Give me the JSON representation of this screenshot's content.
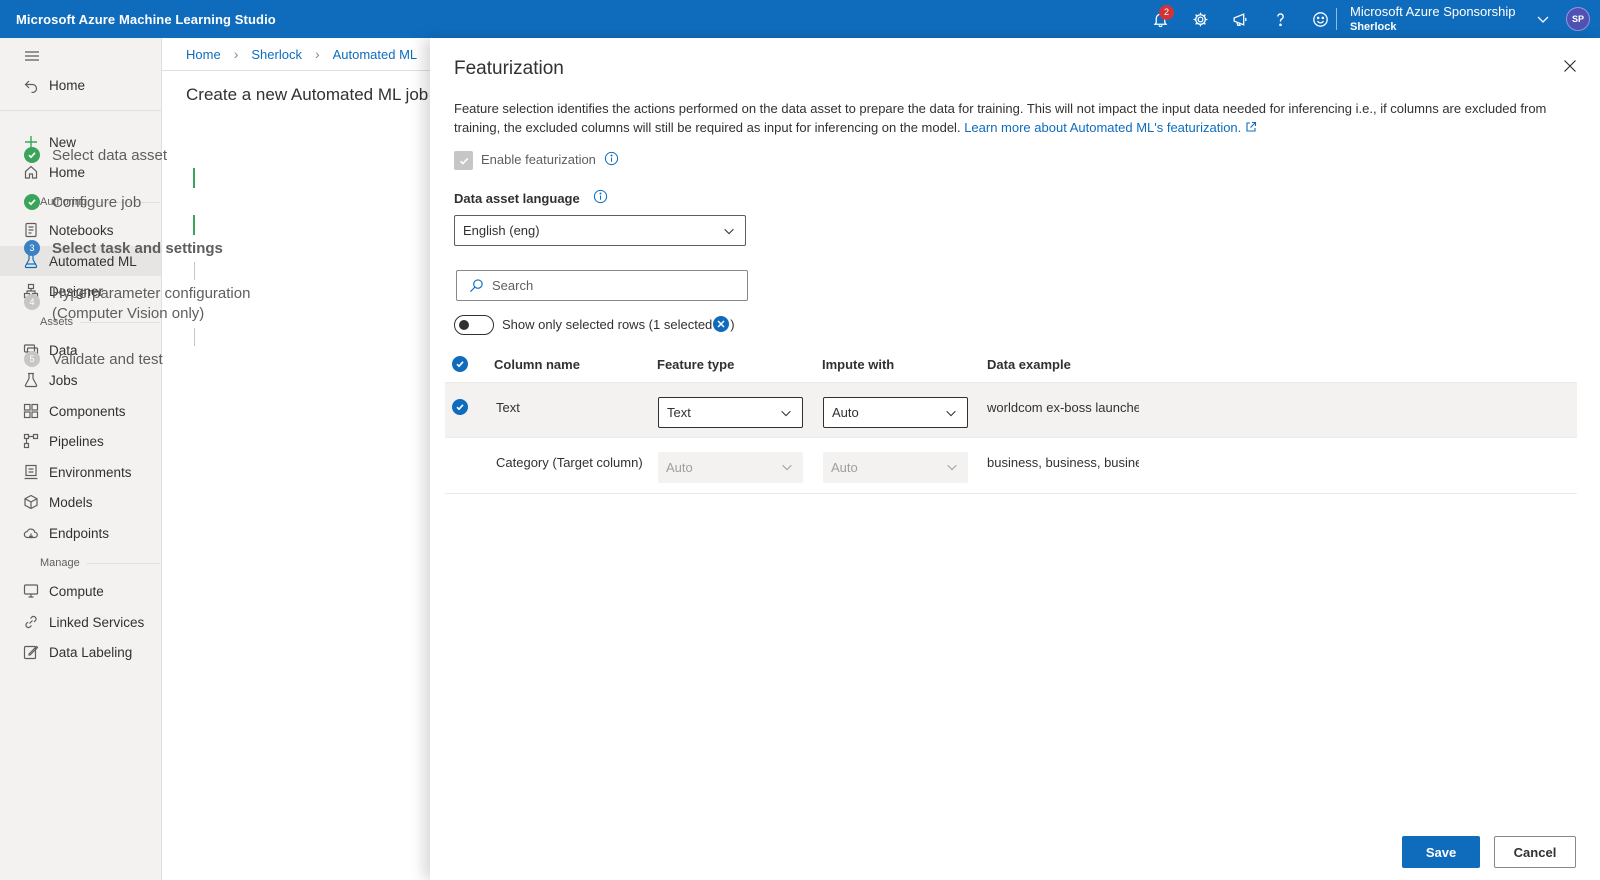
{
  "app": {
    "title": "Microsoft Azure Machine Learning Studio"
  },
  "topbar": {
    "notification_count": "2",
    "icons": [
      "bell-icon",
      "gear-icon",
      "megaphone-icon",
      "help-icon",
      "smiley-icon"
    ],
    "account_name": "Microsoft Azure Sponsorship",
    "workspace_name": "Sherlock",
    "avatar_initials": "SP"
  },
  "sidebar": {
    "top_home": "Home",
    "items": [
      {
        "label": "New",
        "icon": "plus-icon"
      },
      {
        "label": "Home",
        "icon": "home-icon"
      },
      {
        "label": "Notebooks",
        "icon": "notebook-icon"
      },
      {
        "label": "Automated ML",
        "icon": "automl-icon",
        "active": true
      },
      {
        "label": "Designer",
        "icon": "designer-icon"
      },
      {
        "label": "Data",
        "icon": "data-icon"
      },
      {
        "label": "Jobs",
        "icon": "flask-icon"
      },
      {
        "label": "Components",
        "icon": "components-icon"
      },
      {
        "label": "Pipelines",
        "icon": "pipelines-icon"
      },
      {
        "label": "Environments",
        "icon": "environment-icon"
      },
      {
        "label": "Models",
        "icon": "cube-icon"
      },
      {
        "label": "Endpoints",
        "icon": "cloud-icon"
      },
      {
        "label": "Compute",
        "icon": "monitor-icon"
      },
      {
        "label": "Linked Services",
        "icon": "link-icon"
      },
      {
        "label": "Data Labeling",
        "icon": "edit-icon"
      }
    ],
    "sections": {
      "authoring": "Authoring",
      "assets": "Assets",
      "manage": "Manage"
    }
  },
  "breadcrumb": [
    "Home",
    "Sherlock",
    "Automated ML"
  ],
  "wizard": {
    "title": "Create a new Automated ML job",
    "steps": [
      {
        "label": "Select data asset",
        "status": "done"
      },
      {
        "label": "Configure job",
        "status": "done"
      },
      {
        "label": "Select task and settings",
        "status": "current",
        "number": "3"
      },
      {
        "label": "Hyperparameter configuration",
        "label2": "(Computer Vision only)",
        "status": "todo",
        "number": "4"
      },
      {
        "label": "Validate and test",
        "status": "todo",
        "number": "5"
      }
    ]
  },
  "panel": {
    "title": "Featurization",
    "description": "Feature selection identifies the actions performed on the data asset to prepare the data for training. This will not impact the input data needed for inferencing i.e., if columns are excluded from training, the excluded columns will still be required as input for inferencing on the model.",
    "learn_more": "Learn more about Automated ML's featurization.",
    "enable_featurization": "Enable featurization",
    "language_label": "Data asset language",
    "language_value": "English (eng)",
    "search_placeholder": "Search",
    "toggle_label": "Show only selected rows (1 selected",
    "toggle_close": ")",
    "columns": {
      "name": "Column name",
      "feature_type": "Feature type",
      "impute": "Impute with",
      "example": "Data example"
    },
    "rows": [
      {
        "name": "Text",
        "feature_type": "Text",
        "impute": "Auto",
        "example": "worldcom ex-boss launches",
        "selected": true
      },
      {
        "name": "Category (Target column)",
        "feature_type": "Auto",
        "impute": "Auto",
        "example": "business, business, business",
        "selected": false
      }
    ],
    "save": "Save",
    "cancel": "Cancel"
  },
  "colors": {
    "brand": "#0f6cbd",
    "success": "#3aa55a",
    "badge": "#d13438"
  }
}
